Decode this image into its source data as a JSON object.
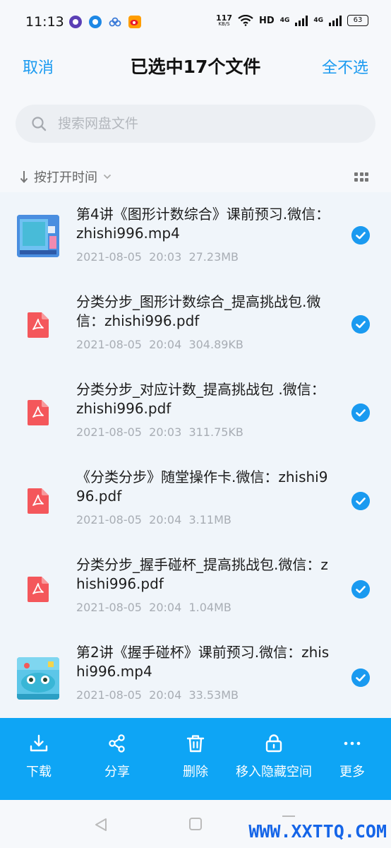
{
  "status_bar": {
    "time": "11:13",
    "net_speed_value": "117",
    "net_speed_unit": "KB/S",
    "hd_label": "HD",
    "sim1_label": "4G",
    "sim2_label": "4G",
    "battery": "63",
    "app_icons": [
      "purple-app-icon",
      "blue-app-icon",
      "cloud-app-icon",
      "weibo-app-icon"
    ]
  },
  "header": {
    "cancel_label": "取消",
    "title": "已选中17个文件",
    "deselect_label": "全不选"
  },
  "search": {
    "placeholder": "搜索网盘文件",
    "value": ""
  },
  "sort": {
    "label": "按打开时间"
  },
  "files": [
    {
      "name": "第4讲《图形计数综合》课前预习.微信：zhishi996.mp4",
      "date": "2021-08-05",
      "time": "20:03",
      "size": "27.23MB",
      "type": "video",
      "selected": true
    },
    {
      "name": "分类分步_图形计数综合_提高挑战包.微信：zhishi996.pdf",
      "date": "2021-08-05",
      "time": "20:04",
      "size": "304.89KB",
      "type": "pdf",
      "selected": true
    },
    {
      "name": "分类分步_对应计数_提高挑战包 .微信：zhishi996.pdf",
      "date": "2021-08-05",
      "time": "20:03",
      "size": "311.75KB",
      "type": "pdf",
      "selected": true
    },
    {
      "name": "《分类分步》随堂操作卡.微信：zhishi996.pdf",
      "date": "2021-08-05",
      "time": "20:04",
      "size": "3.11MB",
      "type": "pdf",
      "selected": true
    },
    {
      "name": "分类分步_握手碰杯_提高挑战包.微信：zhishi996.pdf",
      "date": "2021-08-05",
      "time": "20:04",
      "size": "1.04MB",
      "type": "pdf",
      "selected": true
    },
    {
      "name": "第2讲《握手碰杯》课前预习.微信：zhishi996.mp4",
      "date": "2021-08-05",
      "time": "20:04",
      "size": "33.53MB",
      "type": "video",
      "selected": true
    }
  ],
  "actions": [
    {
      "label": "下载",
      "icon": "download-icon"
    },
    {
      "label": "分享",
      "icon": "share-icon"
    },
    {
      "label": "删除",
      "icon": "trash-icon"
    },
    {
      "label": "移入隐藏空间",
      "icon": "lock-icon"
    },
    {
      "label": "更多",
      "icon": "more-icon"
    }
  ],
  "watermark": "WWW.XXTTQ.COM",
  "colors": {
    "accent": "#1a9af0",
    "action_bar": "#0ea5f5",
    "pdf_red": "#f4575b",
    "watermark": "#1565e8"
  }
}
